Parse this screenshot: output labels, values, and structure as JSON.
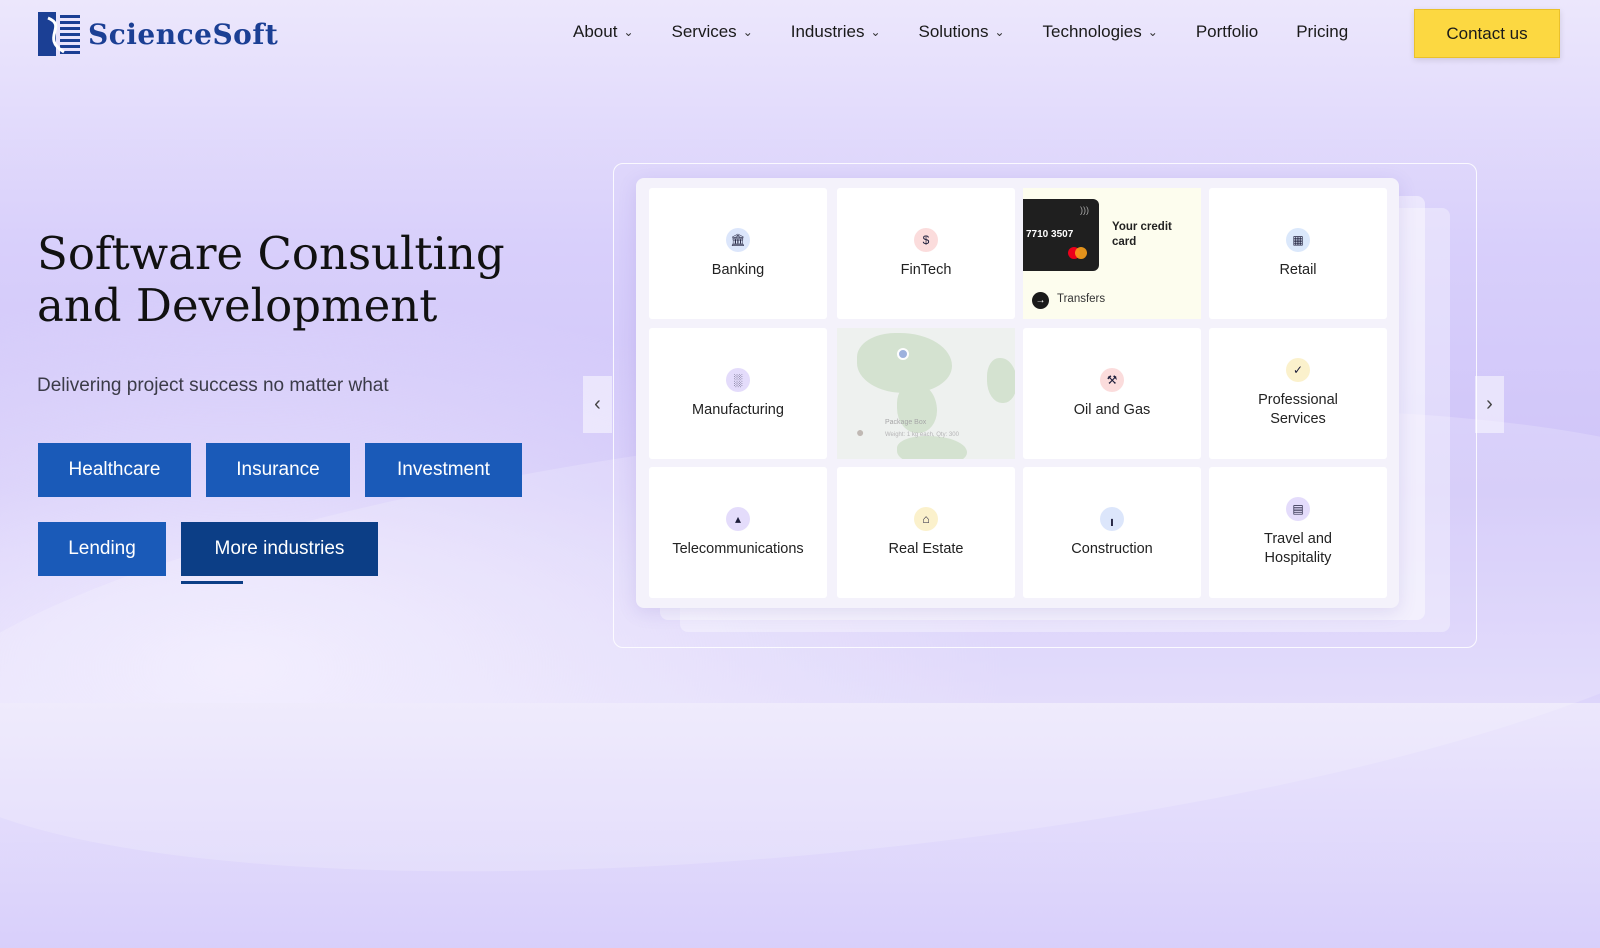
{
  "brand": {
    "name": "ScienceSoft"
  },
  "nav": {
    "items": [
      {
        "label": "About",
        "dropdown": true
      },
      {
        "label": "Services",
        "dropdown": true
      },
      {
        "label": "Industries",
        "dropdown": true
      },
      {
        "label": "Solutions",
        "dropdown": true
      },
      {
        "label": "Technologies",
        "dropdown": true
      },
      {
        "label": "Portfolio",
        "dropdown": false
      },
      {
        "label": "Pricing",
        "dropdown": false
      }
    ],
    "contact_label": "Contact us"
  },
  "hero": {
    "title_line1": "Software Consulting",
    "title_line2": "and Development",
    "subtitle": "Delivering project success no matter what",
    "buttons": [
      "Healthcare",
      "Insurance",
      "Investment",
      "Lending",
      "More industries"
    ]
  },
  "tiles": [
    {
      "label": "Banking",
      "icon": "bank-icon"
    },
    {
      "label": "FinTech",
      "icon": "dollar-icon"
    },
    {
      "label": "Retail",
      "icon": "store-icon"
    },
    {
      "label": "Manufacturing",
      "icon": "factory-icon"
    },
    {
      "label": "Oil and Gas",
      "icon": "oil-pump-icon"
    },
    {
      "label": "Professional Services",
      "icon": "badge-icon"
    },
    {
      "label": "Telecommunications",
      "icon": "antenna-icon"
    },
    {
      "label": "Real Estate",
      "icon": "house-icon"
    },
    {
      "label": "Construction",
      "icon": "crane-icon"
    },
    {
      "label": "Travel and Hospitality",
      "icon": "luggage-icon"
    }
  ],
  "credit_card": {
    "number": "7710 3507",
    "label": "Your credit card",
    "transfers": "Transfers"
  },
  "map_card": {
    "title": "Package Box",
    "subtitle": "Weight: 1 kg each, Qty: 300"
  },
  "colors": {
    "brand": "#1b3f94",
    "button": "#1a5ab8",
    "button_dark": "#0c3e86",
    "cta": "#fcd841"
  }
}
